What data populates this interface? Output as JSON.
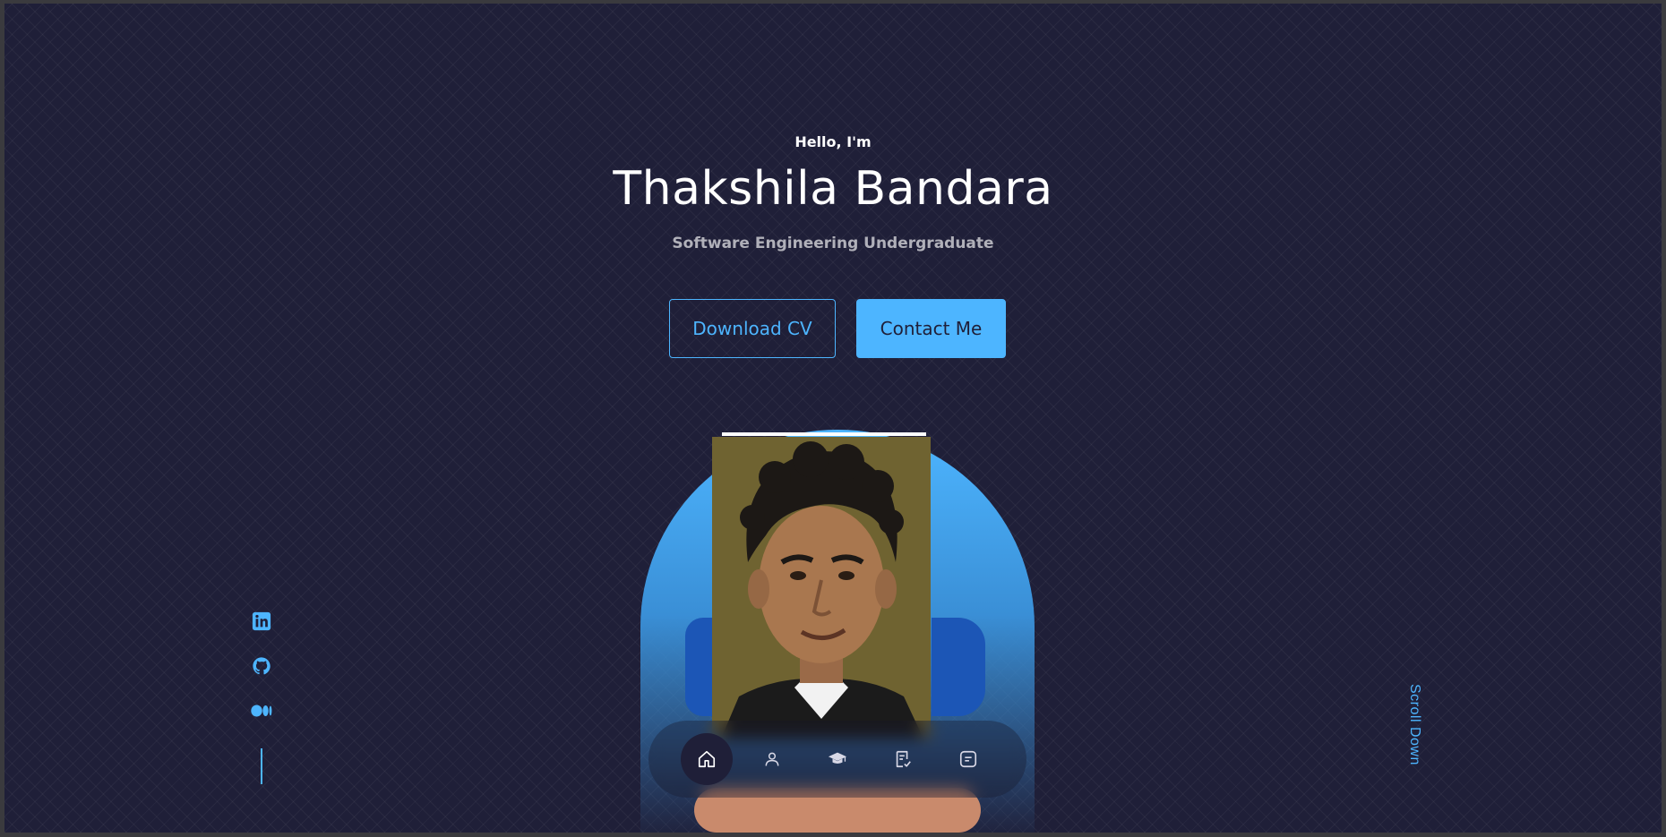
{
  "header": {
    "greeting": "Hello, I'm",
    "name": "Thakshila Bandara",
    "role": "Software Engineering Undergraduate"
  },
  "cta": {
    "download_label": "Download CV",
    "contact_label": "Contact Me"
  },
  "socials": [
    {
      "icon": "linkedin-icon"
    },
    {
      "icon": "github-icon"
    },
    {
      "icon": "medium-icon"
    }
  ],
  "nav": {
    "items": [
      {
        "icon": "home-icon",
        "active": true
      },
      {
        "icon": "user-icon",
        "active": false
      },
      {
        "icon": "graduation-cap-icon",
        "active": false
      },
      {
        "icon": "checklist-icon",
        "active": false
      },
      {
        "icon": "message-icon",
        "active": false
      }
    ]
  },
  "scroll_label": "Scroll Down",
  "colors": {
    "background": "#1f1f38",
    "accent": "#4db5ff",
    "text": "#ffffff"
  }
}
